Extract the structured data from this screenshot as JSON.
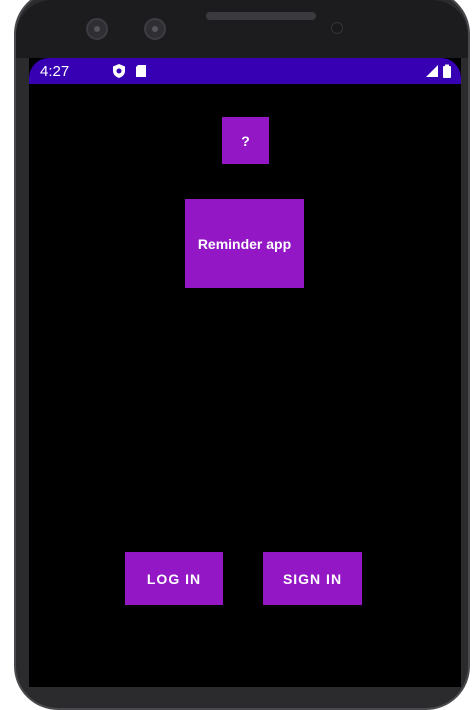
{
  "status_bar": {
    "time": "4:27",
    "icons": [
      "shield-icon",
      "sd-card-icon",
      "signal-icon",
      "battery-icon"
    ],
    "color": "#3700b3"
  },
  "main": {
    "help_label": "?",
    "app_title": "Reminder app",
    "login_label": "LOG IN",
    "signin_label": "SIGN IN"
  },
  "colors": {
    "accent": "#9317c5",
    "background": "#000000"
  }
}
